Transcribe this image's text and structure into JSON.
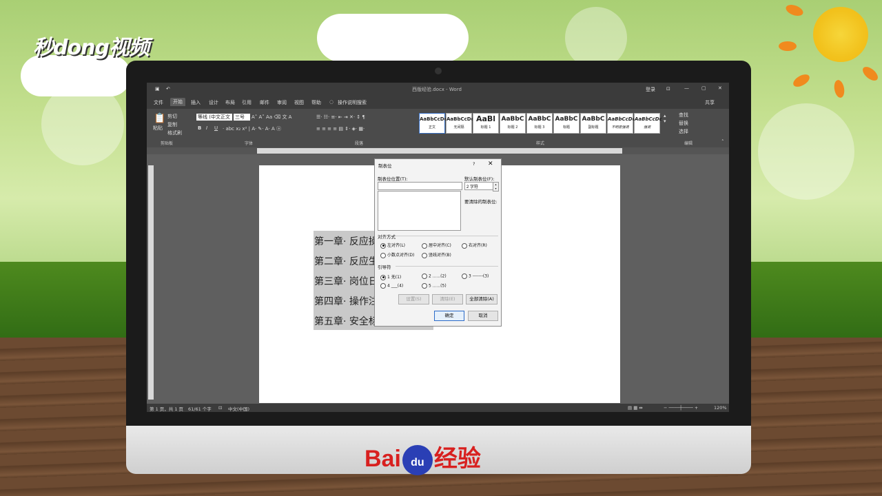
{
  "brand": {
    "watermark": "秒dong视频",
    "bottom_logo_left": "Bai",
    "bottom_logo_paw": "du",
    "bottom_logo_right": "经验"
  },
  "window": {
    "title": "西版经验.docx - Word",
    "login": "登录",
    "share": "共享"
  },
  "tabs": [
    "文件",
    "开始",
    "插入",
    "设计",
    "布局",
    "引用",
    "邮件",
    "审阅",
    "视图",
    "帮助",
    "操作说明搜索"
  ],
  "ribbon": {
    "clipboard": {
      "paste": "粘贴",
      "cut": "剪切",
      "copy": "复制",
      "format_painter": "格式刷",
      "label": "剪贴板"
    },
    "font": {
      "name": "等线 (中文正文",
      "size": "三号",
      "label": "字体"
    },
    "paragraph": {
      "label": "段落"
    },
    "styles": {
      "label": "样式",
      "items": [
        {
          "preview": "AaBbCcDc",
          "name": "正文"
        },
        {
          "preview": "AaBbCcDc",
          "name": "无间隔"
        },
        {
          "preview": "AaBl",
          "name": "标题 1"
        },
        {
          "preview": "AaBbC",
          "name": "标题 2"
        },
        {
          "preview": "AaBbC",
          "name": "标题 3"
        },
        {
          "preview": "AaBbC",
          "name": "标题"
        },
        {
          "preview": "AaBbC",
          "name": "副标题"
        },
        {
          "preview": "AaBbCcDc",
          "name": "不明显强调"
        },
        {
          "preview": "AaBbCcDc",
          "name": "强调"
        }
      ]
    },
    "editing": {
      "find": "查找",
      "replace": "替换",
      "select": "选择",
      "label": "编辑"
    }
  },
  "document": {
    "lines": [
      "第一章· 反应操",
      "第二章· 反应生",
      "第三章· 岗位日",
      "第四章· 操作注",
      "第五章· 安全标"
    ]
  },
  "status": {
    "page": "第 1 页，共 1 页",
    "words": "61/61 个字",
    "lang": "中文(中国)",
    "zoom": "120%"
  },
  "dialog": {
    "title": "制表位",
    "help": "?",
    "close": "✕",
    "tab_stop_label": "制表位位置(T):",
    "tab_stop_value": "",
    "default_label": "默认制表位(F):",
    "default_value": "2 字符",
    "to_clear_label": "要清除的制表位:",
    "alignment_title": "对齐方式",
    "alignment": [
      {
        "label": "左对齐(L)",
        "checked": true
      },
      {
        "label": "居中对齐(C)",
        "checked": false
      },
      {
        "label": "右对齐(R)",
        "checked": false
      },
      {
        "label": "小数点对齐(D)",
        "checked": false
      },
      {
        "label": "竖线对齐(B)",
        "checked": false
      }
    ],
    "leader_title": "引导符",
    "leaders": [
      {
        "label": "1 无(1)",
        "checked": true
      },
      {
        "label": "2 ......(2)",
        "checked": false
      },
      {
        "label": "3 -------(3)",
        "checked": false
      },
      {
        "label": "4 ___(4)",
        "checked": false
      },
      {
        "label": "5 ......(5)",
        "checked": false
      }
    ],
    "set_button": "设置(S)",
    "clear_button": "清除(E)",
    "clear_all_button": "全部清除(A)",
    "ok_button": "确定",
    "cancel_button": "取消"
  }
}
